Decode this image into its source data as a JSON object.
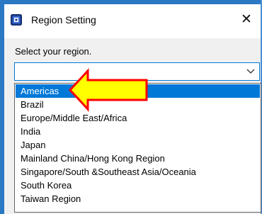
{
  "window": {
    "title": "Region Setting",
    "app_icon": "region-app-icon",
    "close_glyph": "✕"
  },
  "prompt": "Select your region.",
  "combo": {
    "value": "",
    "arrow_icon": "chevron-down-icon"
  },
  "dropdown": {
    "selected_index": 0,
    "options": [
      "Americas",
      "Brazil",
      "Europe/Middle East/Africa",
      "India",
      "Japan",
      "Mainland China/Hong Kong Region",
      "Singapore/South &Southeast Asia/Oceania",
      "South Korea",
      "Taiwan Region"
    ]
  },
  "annotation": {
    "type": "arrow",
    "points_to": "Americas",
    "fill": "#ffff00",
    "stroke": "#ff0000"
  },
  "colors": {
    "frame": "#2b78c5",
    "highlight": "#0078d7",
    "dialog_bg": "#f0f0f0"
  }
}
